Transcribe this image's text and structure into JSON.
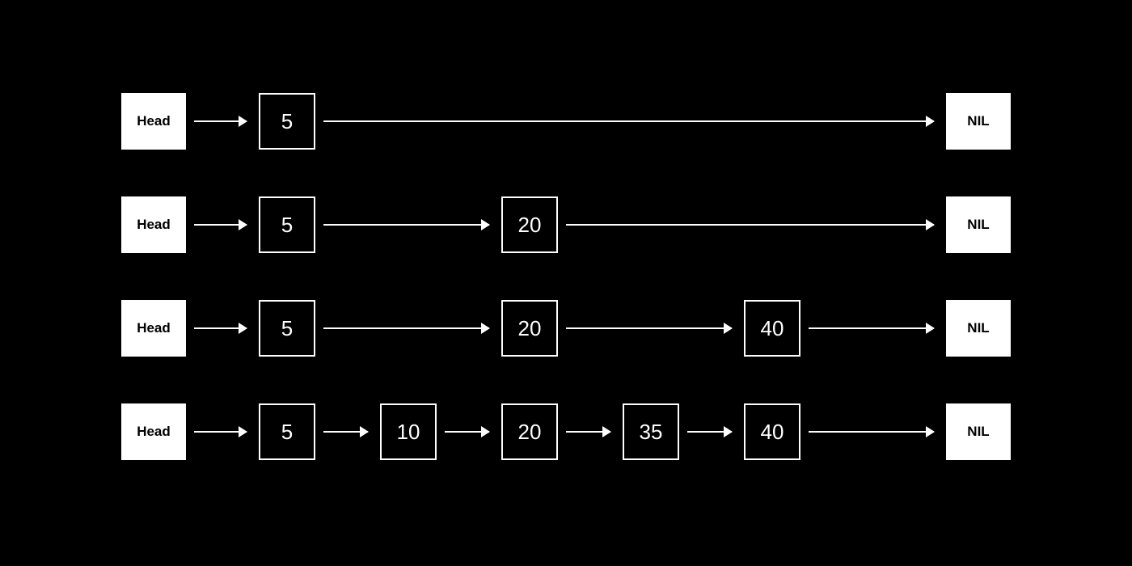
{
  "labels": {
    "head": "Head",
    "nil": "NIL"
  },
  "levels": [
    {
      "nodes": [
        "5"
      ]
    },
    {
      "nodes": [
        "5",
        "20"
      ]
    },
    {
      "nodes": [
        "5",
        "20",
        "40"
      ]
    },
    {
      "nodes": [
        "5",
        "10",
        "20",
        "35",
        "40"
      ]
    }
  ],
  "chart_data": {
    "type": "diagram",
    "structure": "skip-list",
    "description": "Four-level skip list. Each row starts at Head and terminates at NIL. Higher levels are sparse express lanes over the full bottom list.",
    "levels": [
      {
        "level": 3,
        "sequence": [
          "Head",
          5,
          "NIL"
        ]
      },
      {
        "level": 2,
        "sequence": [
          "Head",
          5,
          20,
          "NIL"
        ]
      },
      {
        "level": 1,
        "sequence": [
          "Head",
          5,
          20,
          40,
          "NIL"
        ]
      },
      {
        "level": 0,
        "sequence": [
          "Head",
          5,
          10,
          20,
          35,
          40,
          "NIL"
        ]
      }
    ],
    "base_list": [
      5,
      10,
      20,
      35,
      40
    ]
  }
}
